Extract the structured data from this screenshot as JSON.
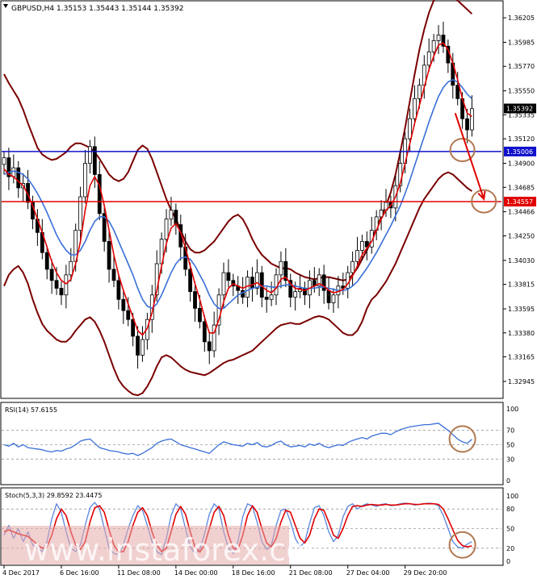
{
  "chart_data": {
    "type": "candlestick",
    "instrument_header": "GBPUSD,H4  1.35153 1.35443 1.35144 1.35392",
    "main": {
      "ylim": [
        1.328,
        1.3635
      ],
      "y_ticks": [
        "1.36205",
        "1.35985",
        "1.35770",
        "1.35550",
        "1.35335",
        "1.35120",
        "1.34900",
        "1.34685",
        "1.34466",
        "1.34250",
        "1.34030",
        "1.33815",
        "1.33595",
        "1.33380",
        "1.33165",
        "1.32945"
      ],
      "current_price": "1.35392",
      "levels": [
        {
          "value": 1.35006,
          "label": "1.35006",
          "color": "#1010cc"
        },
        {
          "value": 1.34557,
          "label": "1.34557",
          "color": "#e00000"
        }
      ],
      "circles": [
        {
          "x": 96,
          "value": 1.3502
        },
        {
          "x": 100.5,
          "value": 1.3456
        }
      ],
      "arrow": {
        "from": [
          94.5,
          1.3535
        ],
        "to": [
          100.5,
          1.3458
        ],
        "color": "#e00000"
      },
      "x_count": 104,
      "close": [
        1.3495,
        1.3478,
        1.3486,
        1.3468,
        1.3472,
        1.3455,
        1.344,
        1.3428,
        1.341,
        1.3395,
        1.3385,
        1.3378,
        1.3372,
        1.339,
        1.3402,
        1.343,
        1.346,
        1.349,
        1.3505,
        1.348,
        1.3445,
        1.342,
        1.3395,
        1.3385,
        1.3368,
        1.3358,
        1.335,
        1.3335,
        1.3318,
        1.3332,
        1.335,
        1.3372,
        1.34,
        1.3422,
        1.344,
        1.3448,
        1.3435,
        1.3415,
        1.3395,
        1.3375,
        1.336,
        1.3348,
        1.333,
        1.3322,
        1.3345,
        1.3372,
        1.3392,
        1.3385,
        1.338,
        1.3376,
        1.337,
        1.3388,
        1.3378,
        1.3392,
        1.337,
        1.3368,
        1.3372,
        1.339,
        1.3402,
        1.3385,
        1.337,
        1.3375,
        1.3378,
        1.3372,
        1.3385,
        1.338,
        1.339,
        1.3376,
        1.3365,
        1.3372,
        1.338,
        1.3378,
        1.3392,
        1.3402,
        1.3412,
        1.342,
        1.3415,
        1.343,
        1.3442,
        1.3448,
        1.3455,
        1.345,
        1.347,
        1.349,
        1.3512,
        1.353,
        1.3548,
        1.356,
        1.3578,
        1.359,
        1.36,
        1.3605,
        1.3595,
        1.358,
        1.356,
        1.3548,
        1.353,
        1.352,
        1.3539
      ],
      "ma_fast": [
        1.3485,
        1.348,
        1.3478,
        1.3474,
        1.347,
        1.3462,
        1.3452,
        1.344,
        1.3428,
        1.3415,
        1.3402,
        1.3392,
        1.3385,
        1.3382,
        1.3386,
        1.34,
        1.342,
        1.3448,
        1.347,
        1.3478,
        1.347,
        1.3452,
        1.343,
        1.3408,
        1.339,
        1.3376,
        1.3364,
        1.3352,
        1.334,
        1.3336,
        1.3342,
        1.3356,
        1.3376,
        1.3398,
        1.3418,
        1.3432,
        1.3436,
        1.3428,
        1.3414,
        1.3398,
        1.3382,
        1.3368,
        1.3352,
        1.3338,
        1.3338,
        1.335,
        1.3366,
        1.3378,
        1.3382,
        1.338,
        1.3378,
        1.338,
        1.3381,
        1.3383,
        1.338,
        1.3376,
        1.3374,
        1.3378,
        1.3386,
        1.3388,
        1.3382,
        1.3378,
        1.3377,
        1.3376,
        1.3378,
        1.338,
        1.3382,
        1.338,
        1.3376,
        1.3374,
        1.3375,
        1.3377,
        1.3382,
        1.3389,
        1.3398,
        1.3408,
        1.3414,
        1.342,
        1.343,
        1.344,
        1.3448,
        1.3452,
        1.346,
        1.3472,
        1.349,
        1.3508,
        1.3526,
        1.3542,
        1.3558,
        1.3574,
        1.3586,
        1.3596,
        1.3598,
        1.3592,
        1.358,
        1.3565,
        1.3548,
        1.3535,
        1.3532
      ],
      "ma_slow": [
        1.348,
        1.3482,
        1.3483,
        1.3482,
        1.348,
        1.3476,
        1.347,
        1.3463,
        1.3455,
        1.3446,
        1.3436,
        1.3426,
        1.3418,
        1.3412,
        1.3408,
        1.3408,
        1.3412,
        1.342,
        1.343,
        1.3438,
        1.3442,
        1.3442,
        1.3438,
        1.343,
        1.342,
        1.341,
        1.34,
        1.339,
        1.3378,
        1.3368,
        1.3362,
        1.336,
        1.3364,
        1.3372,
        1.3382,
        1.3392,
        1.34,
        1.3405,
        1.3406,
        1.3404,
        1.3398,
        1.339,
        1.3382,
        1.3372,
        1.3364,
        1.336,
        1.336,
        1.3364,
        1.3368,
        1.3372,
        1.3374,
        1.3376,
        1.3378,
        1.3379,
        1.338,
        1.338,
        1.3379,
        1.3379,
        1.338,
        1.3381,
        1.3381,
        1.338,
        1.3379,
        1.3378,
        1.3378,
        1.3378,
        1.3379,
        1.3379,
        1.3378,
        1.3377,
        1.3376,
        1.3376,
        1.3377,
        1.338,
        1.3384,
        1.339,
        1.3396,
        1.3403,
        1.341,
        1.3418,
        1.3426,
        1.3434,
        1.3443,
        1.3452,
        1.3463,
        1.3475,
        1.3488,
        1.3501,
        1.3514,
        1.3527,
        1.3539,
        1.355,
        1.3558,
        1.3563,
        1.3565,
        1.3563,
        1.3558,
        1.3552,
        1.3548
      ],
      "bb_upper": [
        1.357,
        1.3562,
        1.3555,
        1.3548,
        1.3538,
        1.3526,
        1.3515,
        1.3504,
        1.3498,
        1.3495,
        1.3493,
        1.3494,
        1.3497,
        1.35,
        1.3505,
        1.3508,
        1.3508,
        1.3506,
        1.3504,
        1.35,
        1.3494,
        1.3487,
        1.348,
        1.3476,
        1.3474,
        1.3476,
        1.3482,
        1.3492,
        1.3502,
        1.3506,
        1.3503,
        1.3494,
        1.3482,
        1.347,
        1.3458,
        1.3448,
        1.344,
        1.343,
        1.342,
        1.3413,
        1.341,
        1.341,
        1.3412,
        1.3416,
        1.342,
        1.3426,
        1.3432,
        1.3438,
        1.3442,
        1.3444,
        1.344,
        1.3432,
        1.3422,
        1.3414,
        1.3408,
        1.3404,
        1.34,
        1.3398,
        1.3396,
        1.3396,
        1.3395,
        1.3392,
        1.339,
        1.3388,
        1.3387,
        1.3386,
        1.3387,
        1.3388,
        1.3388,
        1.3387,
        1.3386,
        1.3385,
        1.3386,
        1.339,
        1.3396,
        1.3404,
        1.3412,
        1.3422,
        1.3432,
        1.3442,
        1.3452,
        1.3464,
        1.348,
        1.35,
        1.3522,
        1.3546,
        1.357,
        1.3592,
        1.361,
        1.3625,
        1.3636,
        1.3644,
        1.3646,
        1.3644,
        1.364,
        1.3636,
        1.3632,
        1.3628,
        1.3624
      ],
      "bb_lower": [
        1.338,
        1.339,
        1.3395,
        1.3398,
        1.3392,
        1.3382,
        1.3368,
        1.3356,
        1.3346,
        1.334,
        1.3336,
        1.3332,
        1.333,
        1.333,
        1.3334,
        1.334,
        1.3345,
        1.335,
        1.3352,
        1.3348,
        1.334,
        1.333,
        1.3318,
        1.3306,
        1.3296,
        1.329,
        1.3286,
        1.3283,
        1.3282,
        1.3284,
        1.329,
        1.3298,
        1.3308,
        1.3316,
        1.3318,
        1.3316,
        1.3312,
        1.3308,
        1.3305,
        1.3303,
        1.3302,
        1.3301,
        1.33,
        1.3302,
        1.3305,
        1.3308,
        1.3311,
        1.3313,
        1.3314,
        1.3316,
        1.3318,
        1.332,
        1.3322,
        1.3326,
        1.333,
        1.3334,
        1.3338,
        1.3342,
        1.3345,
        1.3346,
        1.3347,
        1.3346,
        1.3346,
        1.3348,
        1.335,
        1.3352,
        1.3353,
        1.3352,
        1.335,
        1.3346,
        1.3342,
        1.3338,
        1.3336,
        1.3336,
        1.334,
        1.3348,
        1.336,
        1.3368,
        1.3372,
        1.3378,
        1.3384,
        1.3392,
        1.34,
        1.341,
        1.342,
        1.343,
        1.344,
        1.345,
        1.3458,
        1.3464,
        1.347,
        1.3476,
        1.348,
        1.3482,
        1.348,
        1.3476,
        1.3472,
        1.3468,
        1.3465
      ]
    },
    "rsi": {
      "label": "RSI(14) 57.6155",
      "levels": [
        "100",
        "70",
        "50",
        "30",
        "0"
      ],
      "ylim": [
        0,
        100
      ],
      "values": [
        50,
        48,
        52,
        47,
        50,
        46,
        45,
        44,
        43,
        41,
        40,
        42,
        41,
        44,
        46,
        50,
        55,
        57,
        58,
        52,
        46,
        44,
        42,
        41,
        40,
        38,
        37,
        38,
        35,
        38,
        42,
        46,
        52,
        55,
        57,
        58,
        54,
        50,
        48,
        46,
        44,
        42,
        40,
        38,
        44,
        50,
        54,
        52,
        50,
        49,
        48,
        52,
        50,
        53,
        48,
        47,
        49,
        53,
        55,
        50,
        47,
        48,
        49,
        47,
        51,
        49,
        52,
        48,
        46,
        48,
        50,
        49,
        53,
        56,
        58,
        60,
        58,
        62,
        64,
        66,
        66,
        64,
        68,
        71,
        73,
        75,
        76,
        77,
        78,
        78,
        79,
        80,
        75,
        70,
        64,
        58,
        54,
        52,
        57.6
      ],
      "circle_x": 96,
      "circle_value": 58
    },
    "stoch": {
      "label": "Stoch(5,3,3) 29.8592 23.4475",
      "levels": [
        "100",
        "80",
        "50",
        "20",
        "0"
      ],
      "ylim": [
        0,
        100
      ],
      "main": [
        40,
        55,
        35,
        50,
        30,
        45,
        25,
        20,
        15,
        30,
        65,
        88,
        75,
        45,
        20,
        15,
        25,
        55,
        82,
        90,
        80,
        50,
        20,
        12,
        10,
        25,
        50,
        70,
        85,
        78,
        55,
        30,
        15,
        10,
        35,
        70,
        88,
        80,
        50,
        22,
        12,
        18,
        42,
        72,
        88,
        80,
        45,
        20,
        12,
        30,
        68,
        88,
        84,
        60,
        30,
        18,
        25,
        55,
        78,
        80,
        60,
        35,
        22,
        30,
        58,
        82,
        85,
        70,
        45,
        30,
        40,
        68,
        84,
        88,
        80,
        85,
        88,
        86,
        84,
        87,
        88,
        85,
        86,
        88,
        89,
        88,
        86,
        87,
        88,
        89,
        88,
        85,
        70,
        50,
        30,
        22,
        20,
        26,
        29.9
      ],
      "signal": [
        45,
        48,
        45,
        42,
        40,
        38,
        32,
        25,
        20,
        22,
        40,
        65,
        80,
        70,
        45,
        25,
        18,
        30,
        60,
        82,
        85,
        75,
        48,
        25,
        14,
        15,
        30,
        55,
        75,
        82,
        70,
        45,
        25,
        15,
        20,
        45,
        72,
        84,
        72,
        45,
        22,
        14,
        25,
        50,
        75,
        84,
        70,
        40,
        20,
        18,
        40,
        70,
        85,
        75,
        50,
        28,
        22,
        35,
        60,
        78,
        75,
        55,
        35,
        28,
        40,
        65,
        80,
        78,
        60,
        40,
        35,
        50,
        70,
        84,
        85,
        84,
        86,
        87,
        86,
        86,
        87,
        86,
        86,
        87,
        88,
        88,
        87,
        87,
        88,
        88,
        88,
        87,
        80,
        65,
        48,
        32,
        24,
        22,
        23.4
      ],
      "circle_x": 96,
      "circle_value": 25
    },
    "x_labels": [
      {
        "i": 0,
        "text": "4 Dec 2017"
      },
      {
        "i": 12,
        "text": "6 Dec 16:00"
      },
      {
        "i": 24,
        "text": "11 Dec 08:00"
      },
      {
        "i": 36,
        "text": "14 Dec 00:00"
      },
      {
        "i": 48,
        "text": "18 Dec 16:00"
      },
      {
        "i": 60,
        "text": "21 Dec 08:00"
      },
      {
        "i": 72,
        "text": "27 Dec 04:00"
      },
      {
        "i": 84,
        "text": "29 Dec 20:00"
      }
    ],
    "colors": {
      "candle": "#000000",
      "ma_fast": "#e00000",
      "ma_slow": "#3a6fd8",
      "bands": "#7a0000",
      "rsi": "#3a6fd8",
      "stoch_main": "#5a87dd",
      "stoch_signal": "#e00000",
      "circle": "#b07850",
      "hline_blue": "#1010cc",
      "hline_red": "#e00000"
    }
  },
  "watermark": "www.instaforex.com"
}
